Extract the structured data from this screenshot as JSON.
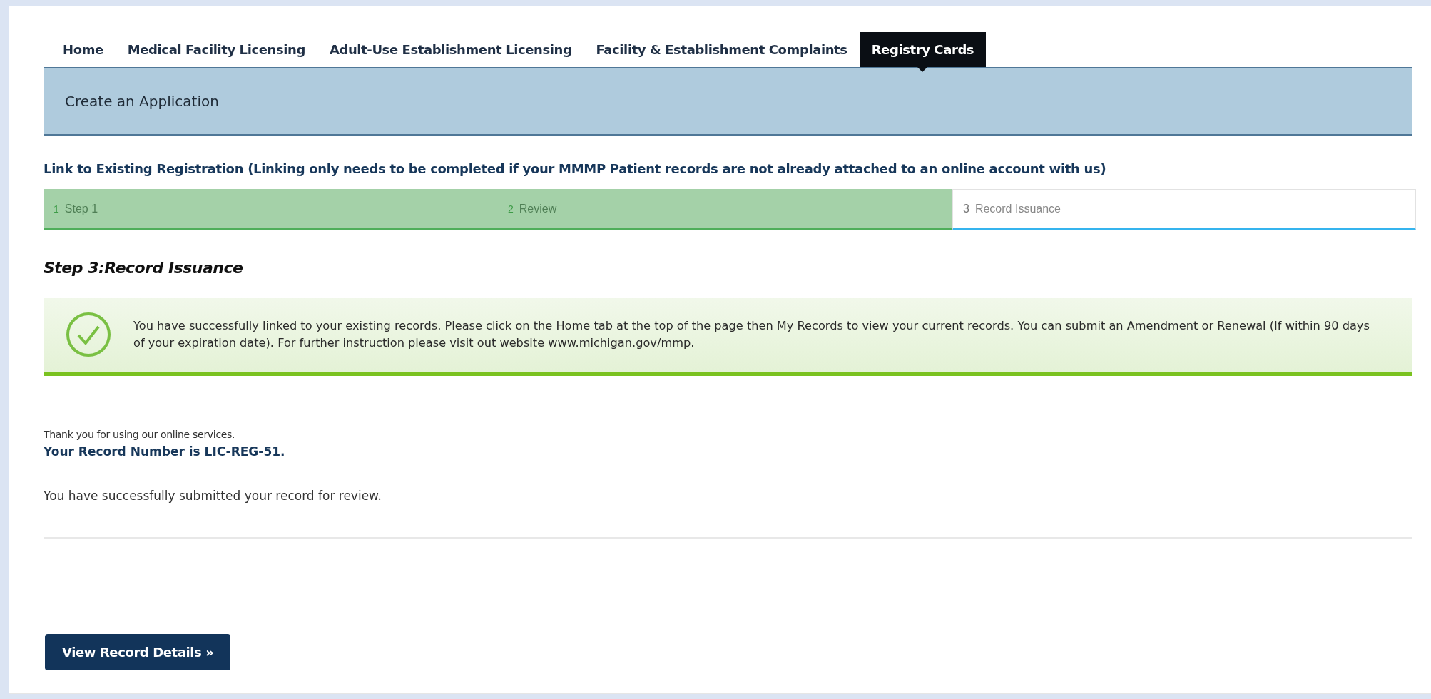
{
  "tabs": [
    {
      "label": "Home",
      "selected": false
    },
    {
      "label": "Medical Facility Licensing",
      "selected": false
    },
    {
      "label": "Adult-Use Establishment Licensing",
      "selected": false
    },
    {
      "label": "Facility & Establishment Complaints",
      "selected": false
    },
    {
      "label": "Registry Cards",
      "selected": true
    }
  ],
  "header": {
    "title": "Create an Application"
  },
  "section_title": "Link to Existing Registration (Linking only needs to be completed if your MMMP Patient records are not already attached to an online account with us)",
  "steps": [
    {
      "number": "1",
      "label": "Step 1",
      "completed": true
    },
    {
      "number": "2",
      "label": "Review",
      "completed": true
    },
    {
      "number": "3",
      "label": "Record Issuance",
      "completed": false
    }
  ],
  "step_heading": "Step 3:Record Issuance",
  "message": {
    "kind": "success",
    "text": "You have successfully linked to your existing records.  Please click on the Home tab at the top of the page then My Records to view your current records.  You can submit an Amendment or Renewal (If within 90 days of your expiration date).  For further instruction please visit out website www.michigan.gov/mmp."
  },
  "thanks": "Thank you for using our online services.",
  "record_number": "Your Record Number is LIC-REG-51.",
  "submitted": "You have successfully submitted your record for review.",
  "button": "View Record Details »"
}
